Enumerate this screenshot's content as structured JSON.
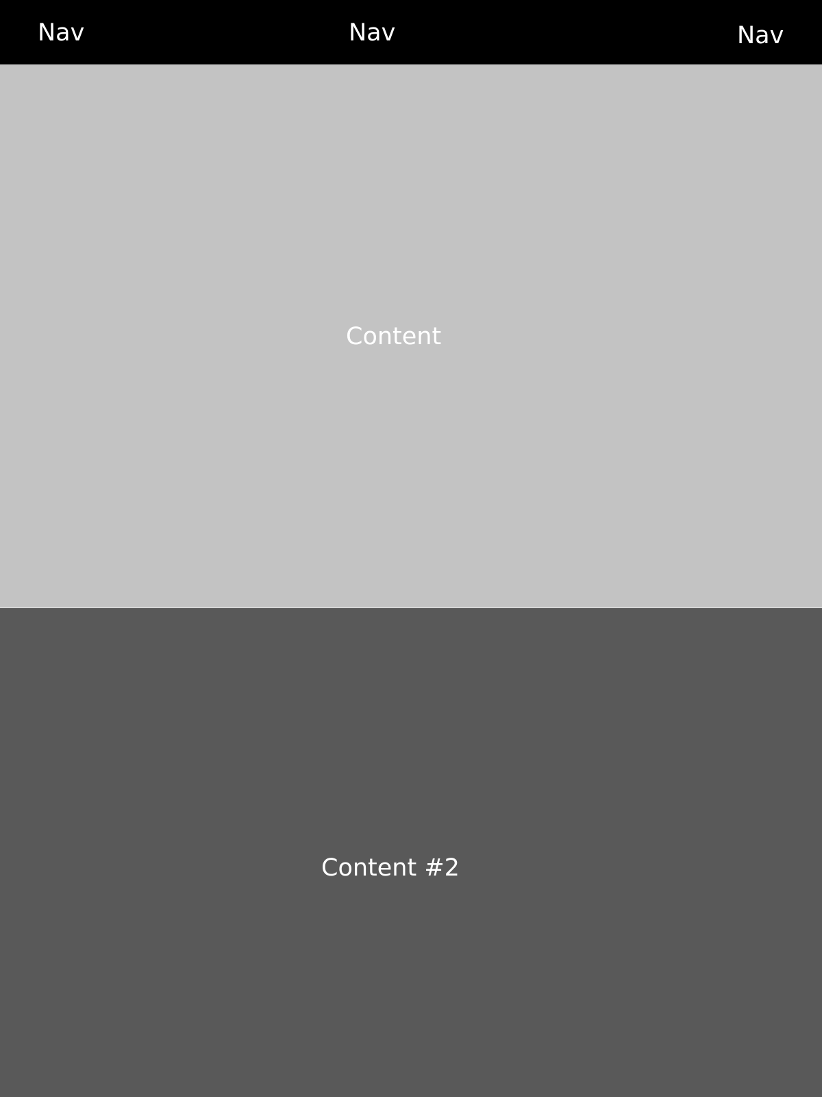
{
  "nav": {
    "items": [
      {
        "label": "Nav"
      },
      {
        "label": "Nav"
      },
      {
        "label": "Nav"
      }
    ]
  },
  "sections": [
    {
      "label": "Content"
    },
    {
      "label": "Content #2"
    }
  ],
  "colors": {
    "nav_background": "#000000",
    "section_1_background": "#c3c3c3",
    "section_2_background": "#595959",
    "text": "#ffffff"
  }
}
